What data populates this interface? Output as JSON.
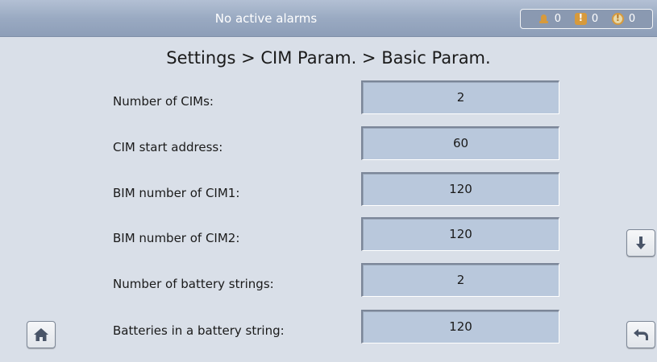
{
  "status": {
    "alarm_message": "No active alarms",
    "counts": [
      {
        "icon": "bell-icon",
        "value": "0"
      },
      {
        "icon": "minor-alarm-icon",
        "value": "0"
      },
      {
        "icon": "critical-alarm-icon",
        "value": "0"
      }
    ]
  },
  "breadcrumb": "Settings > CIM Param. > Basic Param.",
  "params": [
    {
      "label": "Number of CIMs:",
      "value": "2"
    },
    {
      "label": "CIM start address:",
      "value": "60"
    },
    {
      "label": "BIM number of CIM1:",
      "value": "120"
    },
    {
      "label": "BIM number of CIM2:",
      "value": "120"
    },
    {
      "label": "Number of battery strings:",
      "value": "2"
    },
    {
      "label": "Batteries in a battery string:",
      "value": "120"
    }
  ],
  "nav": {
    "home_icon": "home-icon",
    "down_icon": "arrow-down-icon",
    "back_icon": "back-icon"
  },
  "colors": {
    "background": "#d9dfe8",
    "topbar": "#9aaac2",
    "value_box": "#b9c8dc",
    "alarm_accent": "#d79a3c"
  }
}
